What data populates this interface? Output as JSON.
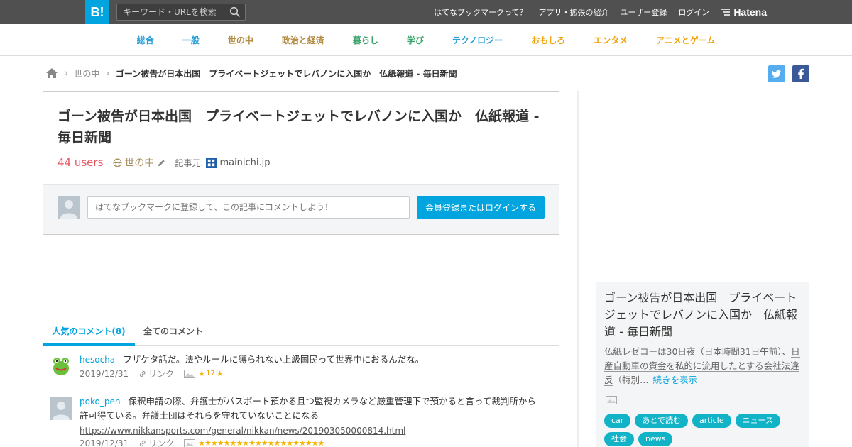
{
  "header": {
    "logo_text": "B!",
    "search_placeholder": "キーワード・URLを検索",
    "nav": [
      "はてなブックマークって？",
      "アプリ・拡張の紹介",
      "ユーザー登録",
      "ログイン"
    ],
    "brand": "Hatena"
  },
  "categories": [
    {
      "label": "総合",
      "color": "#2a9fd6"
    },
    {
      "label": "一般",
      "color": "#2a9fd6"
    },
    {
      "label": "世の中",
      "color": "#b48c42"
    },
    {
      "label": "政治と経済",
      "color": "#b48c42"
    },
    {
      "label": "暮らし",
      "color": "#3aa36a"
    },
    {
      "label": "学び",
      "color": "#3aa36a"
    },
    {
      "label": "テクノロジー",
      "color": "#2a9fd6"
    },
    {
      "label": "おもしろ",
      "color": "#f0a30a"
    },
    {
      "label": "エンタメ",
      "color": "#f0a30a"
    },
    {
      "label": "アニメとゲーム",
      "color": "#f0a30a"
    }
  ],
  "breadcrumb": {
    "category": "世の中",
    "current": "ゴーン被告が日本出国　プライベートジェットでレバノンに入国か　仏紙報道 - 毎日新聞"
  },
  "entry": {
    "title": "ゴーン被告が日本出国　プライベートジェットでレバノンに入国か　仏紙報道 - 毎日新聞",
    "users": "44 users",
    "category": "世の中",
    "source_label": "記事元:",
    "source": "mainichi.jp",
    "comment_placeholder": "はてなブックマークに登録して、この記事にコメントしよう！",
    "login_button": "会員登録またはログインする"
  },
  "tabs": {
    "popular": "人気のコメント(8)",
    "all": "全てのコメント"
  },
  "comments": [
    {
      "user": "hesocha",
      "text": "フザケタ話だ。法やルールに縛られない上級国民って世界中におるんだな。",
      "date": "2019/12/31",
      "link_label": "リンク",
      "star_count": "17"
    },
    {
      "user": "poko_pen",
      "text": "保釈申請の際、弁護士がパスポート預かる且つ監視カメラなど厳重管理下で預かると言って裁判所から許可得ている。弁護士団はそれらを守れていないことになる",
      "url": "https://www.nikkansports.com/general/nikkan/news/201903050000814.html",
      "date": "2019/12/31",
      "link_label": "リンク",
      "stars": "★★★★★★★★★★★★★★★★★★★★"
    }
  ],
  "sidebar": {
    "title": "ゴーン被告が日本出国　プライベートジェットでレバノンに入国か　仏紙報道 - 毎日新聞",
    "desc_plain": "仏紙レゼコーは30日夜（日本時間31日午前）、",
    "desc_underlined": "日産自動車の資金を私的に流用したとする会社法違反",
    "desc_tail": "（特別…",
    "more": "続きを表示",
    "tags": [
      "car",
      "あとで読む",
      "article",
      "ニュース",
      "社会",
      "news"
    ]
  }
}
